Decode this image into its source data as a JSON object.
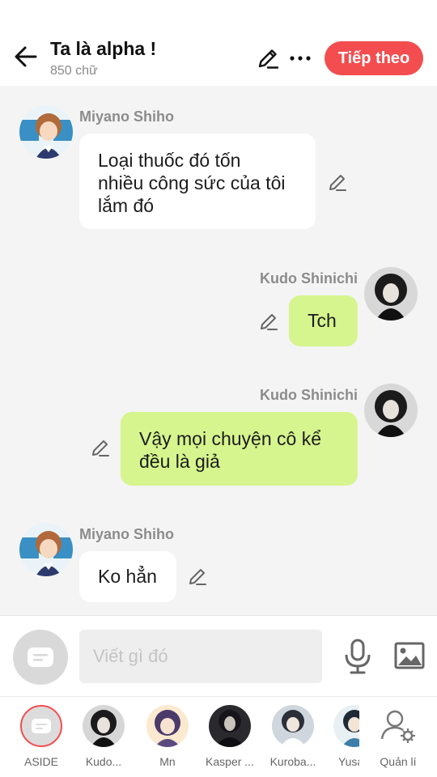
{
  "header": {
    "title": "Ta là alpha !",
    "word_count": "850 chữ",
    "next_label": "Tiếp theo",
    "accent": "#f34d4f"
  },
  "messages": [
    {
      "speaker": "Miyano Shiho",
      "side": "left",
      "text_lines": [
        "Loại thuốc đó tốn",
        "nhiều công sức của tôi",
        "lắm đó"
      ]
    },
    {
      "speaker": "Kudo Shinichi",
      "side": "right",
      "text_lines": [
        "Tch"
      ]
    },
    {
      "speaker": "Kudo Shinichi",
      "side": "right",
      "text_lines": [
        "Vậy mọi chuyện cô kể",
        "đều là giả"
      ]
    },
    {
      "speaker": "Miyano Shiho",
      "side": "left",
      "text_lines": [
        "Ko hẳn"
      ]
    }
  ],
  "composer": {
    "placeholder": "Viết gì đó"
  },
  "cast": [
    {
      "label": "ASIDE"
    },
    {
      "label": "Kudo..."
    },
    {
      "label": "Mn"
    },
    {
      "label": "Kasper ..."
    },
    {
      "label": "Kuroba..."
    },
    {
      "label": "Yusa"
    },
    {
      "label": "Quản lí"
    }
  ],
  "icons": {
    "back": "arrow-left-icon",
    "edit": "pencil-icon",
    "more": "ellipsis-icon",
    "mic": "microphone-icon",
    "image": "image-icon",
    "aside": "chat-bubble-icon",
    "manage": "user-gear-icon"
  },
  "colors": {
    "bubble_left": "#ffffff",
    "bubble_right": "#d6f58e",
    "chat_bg": "#f4f4f4"
  }
}
